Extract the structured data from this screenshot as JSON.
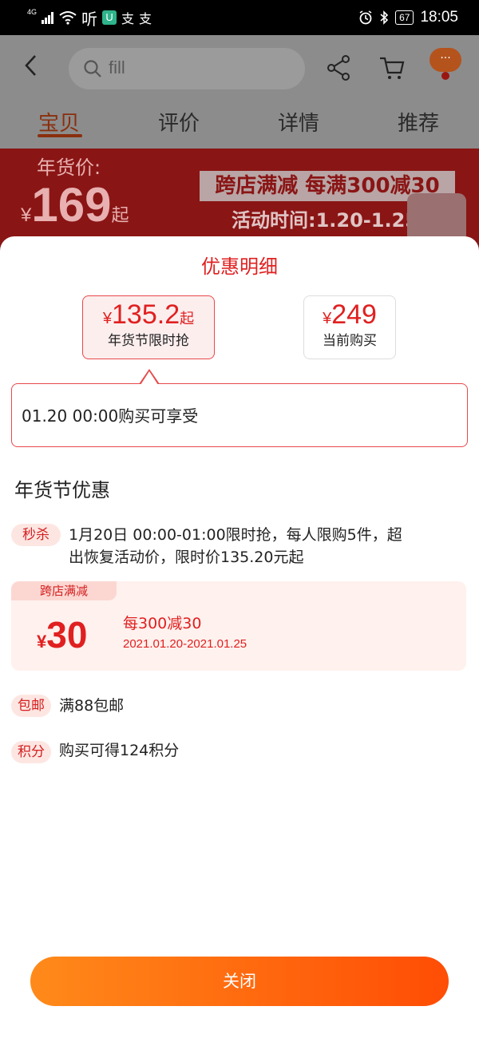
{
  "status_bar": {
    "network": "4G",
    "app_icons": [
      "听",
      "U",
      "支",
      "支"
    ],
    "battery": "67",
    "time": "18:05"
  },
  "nav": {
    "search_text": "fill",
    "more": "···"
  },
  "tabs": [
    {
      "label": "宝贝",
      "active": true
    },
    {
      "label": "评价",
      "active": false
    },
    {
      "label": "详情",
      "active": false
    },
    {
      "label": "推荐",
      "active": false
    }
  ],
  "promo": {
    "price_label": "年货价:",
    "currency": "¥",
    "price": "169",
    "suffix": "起",
    "banner": "跨店满减 每满300减30",
    "activity_time": "活动时间:1.20-1.25"
  },
  "sheet": {
    "title": "优惠明细",
    "price_options": [
      {
        "currency": "¥",
        "amount": "135.2",
        "suffix": "起",
        "label": "年货节限时抢",
        "selected": true
      },
      {
        "currency": "¥",
        "amount": "249",
        "suffix": "",
        "label": "当前购买",
        "selected": false
      }
    ],
    "tip": "01.20 00:00购买可享受",
    "section_title": "年货节优惠",
    "flash_sale": {
      "tag": "秒杀",
      "line1": "1月20日 00:00-01:00限时抢，每人限购5件，超",
      "line2": "出恢复活动价，限时价135.20元起"
    },
    "coupon": {
      "tag": "跨店满减",
      "currency": "¥",
      "amount": "30",
      "rule": "每300减30",
      "date_range": "2021.01.20-2021.01.25"
    },
    "shipping": {
      "tag": "包邮",
      "text": "满88包邮"
    },
    "points": {
      "tag": "积分",
      "text": "购买可得124积分"
    },
    "close_label": "关闭"
  },
  "colors": {
    "accent": "#e02020",
    "button_start": "#ff8a1a",
    "button_end": "#ff4d05"
  }
}
